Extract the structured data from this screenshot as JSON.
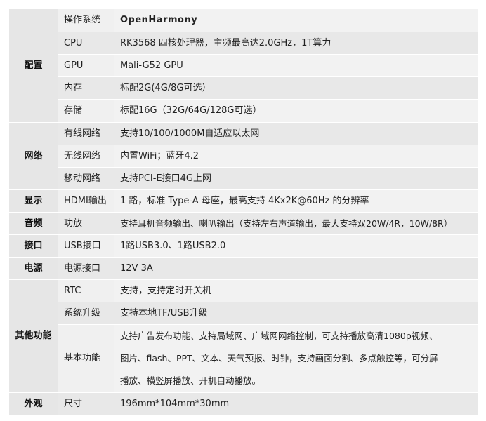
{
  "sections": [
    {
      "category": "配置",
      "rows": [
        {
          "key": "操作系统",
          "value": "OpenHarmony"
        },
        {
          "key": "CPU",
          "value": "RK3568 四核处理器，主频最高达2.0GHz，1T算力"
        },
        {
          "key": "GPU",
          "value": "Mali-G52 GPU"
        },
        {
          "key": "内存",
          "value": "标配2G(4G/8G可选）"
        },
        {
          "key": "存储",
          "value": "标配16G（32G/64G/128G可选）"
        }
      ]
    },
    {
      "category": "网络",
      "rows": [
        {
          "key": "有线网络",
          "value": "支持10/100/1000M自适应以太网"
        },
        {
          "key": "无线网络",
          "value": "内置WiFi；蓝牙4.2"
        },
        {
          "key": "移动网络",
          "value": "支持PCI-E接口4G上网"
        }
      ]
    },
    {
      "category": "显示",
      "rows": [
        {
          "key": "HDMI输出",
          "value": "1 路，标准 Type-A 母座，最高支持 4Kx2K@60Hz 的分辨率"
        }
      ]
    },
    {
      "category": "音频",
      "rows": [
        {
          "key": "功放",
          "value": "支持耳机音频输出、喇叭输出（支持左右声道输出，最大支持双20W/4R，10W/8R）"
        }
      ]
    },
    {
      "category": "接口",
      "rows": [
        {
          "key": "USB接口",
          "value": "1路USB3.0、1路USB2.0"
        }
      ]
    },
    {
      "category": "电源",
      "rows": [
        {
          "key": "电源接口",
          "value": "12V 3A"
        }
      ]
    },
    {
      "category": "其他功能",
      "rows": [
        {
          "key": "RTC",
          "value": "支持，支持定时开关机"
        },
        {
          "key": "系统升级",
          "value": "支持本地TF/USB升级"
        },
        {
          "key": "基本功能",
          "value_lines": [
            "支持广告发布功能、支持局域网、广域网网络控制，可支持播放高清1080p视频、",
            "图片、flash、PPT、文本、天气预报、时钟，支持画面分割、多点触控等，可分屏",
            "播放、横竖屏播放、开机自动播放。"
          ]
        }
      ]
    },
    {
      "category": "外观",
      "rows": [
        {
          "key": "尺寸",
          "value": "196mm*104mm*30mm"
        }
      ]
    }
  ]
}
